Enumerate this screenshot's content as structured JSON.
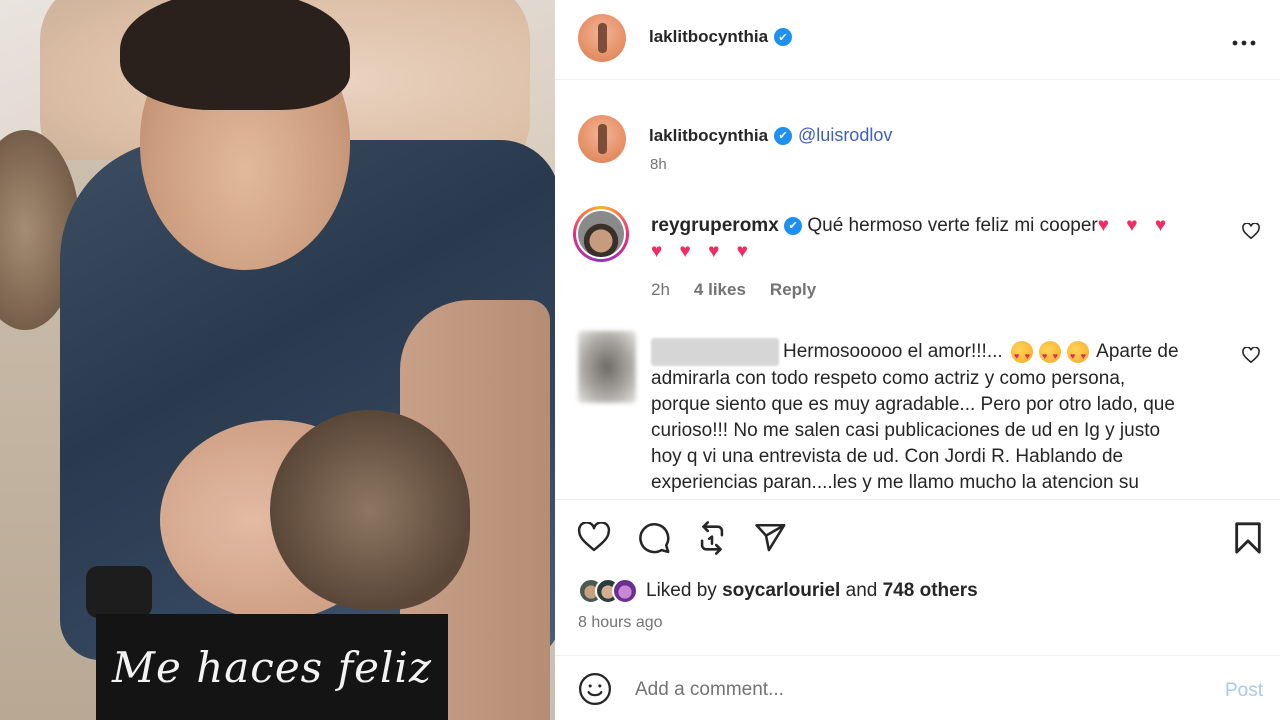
{
  "photo": {
    "overlay_text": "Me haces feliz"
  },
  "post": {
    "author": "laklitbocynthia",
    "verified_mark": "✔",
    "caption": {
      "author": "laklitbocynthia",
      "mention": "@luisrodlov",
      "time": "8h"
    }
  },
  "comments": [
    {
      "username": "reygruperomx",
      "text": "Qué hermoso verte feliz mi cooper",
      "hearts_line1": "♥ ♥ ♥",
      "hearts_line2": "♥ ♥ ♥ ♥",
      "time": "2h",
      "likes": "4 likes",
      "reply": "Reply"
    },
    {
      "username_blurred": true,
      "line1": "Hermosooooo el amor!!!...",
      "line1_tail": "Aparte de",
      "line2": "admirarla con todo respeto como actriz y como persona,",
      "line3": "porque siento que es muy agradable... Pero por otro lado, que",
      "line4": "curioso!!! No me salen casi publicaciones de ud en Ig y justo",
      "line5": "hoy q vi una entrevista de ud. Con Jordi R. Hablando de",
      "line6": "experiencias paran....les y me llamo mucho la atencion su"
    }
  ],
  "actions": {
    "liked_by_prefix": "Liked by",
    "liked_by_user": "soycarlouriel",
    "and_text": "and",
    "others": "748 others",
    "time_ago": "8 hours ago"
  },
  "add_comment": {
    "placeholder": "Add a comment...",
    "post_label": "Post"
  },
  "icons": {
    "more": "more-options-icon",
    "like": "heart-icon",
    "comment": "comment-icon",
    "repost": "repost-icon",
    "share": "send-icon",
    "save": "bookmark-icon",
    "emoji": "emoji-icon"
  },
  "colors": {
    "verified": "#1f8ff0",
    "mention": "#3f5fb8",
    "post_button": "#a8c9f5",
    "heart_emoji": "#ef2d64"
  }
}
